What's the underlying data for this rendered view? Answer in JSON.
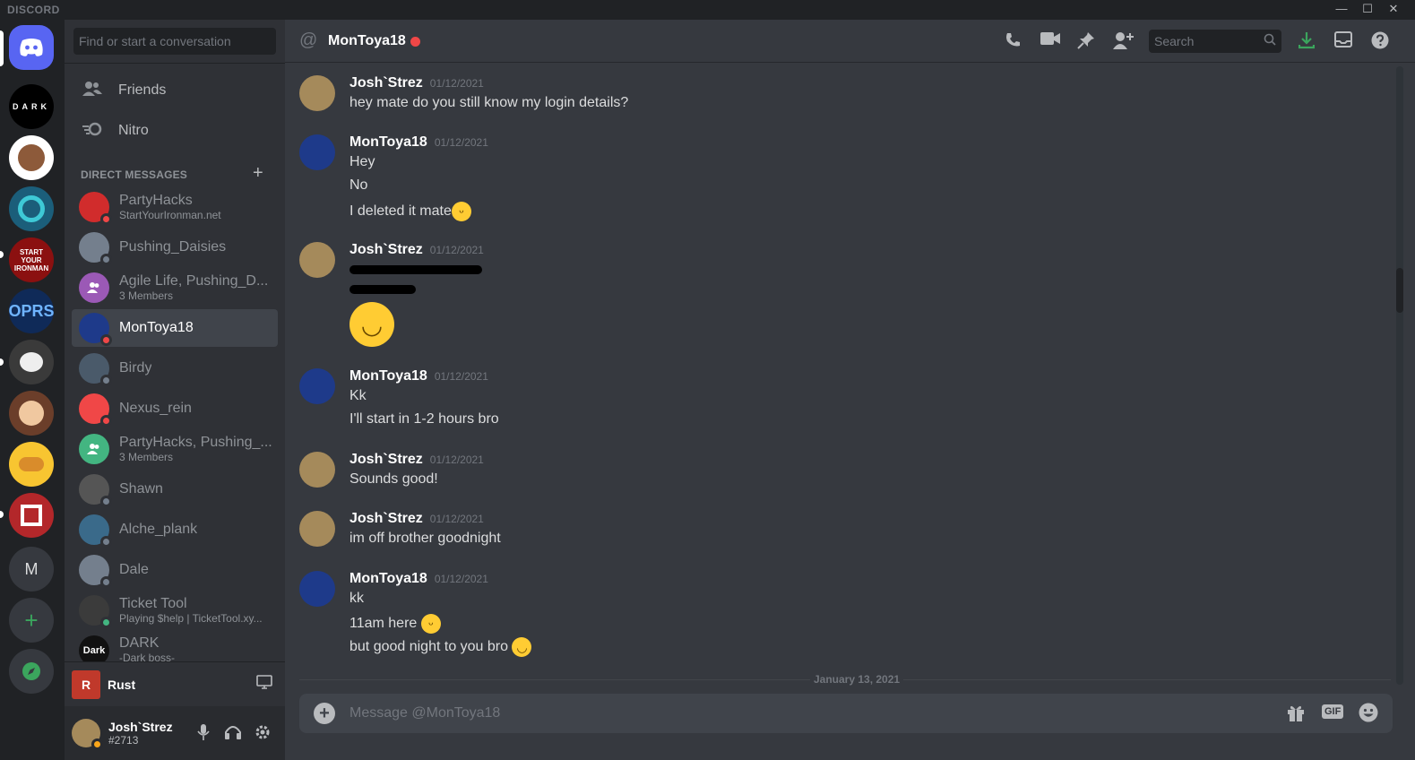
{
  "app": {
    "brand": "DISCORD",
    "window_controls": [
      "—",
      "☐",
      "✕"
    ]
  },
  "guilds": [
    {
      "label": "",
      "color": "#5865f2",
      "icon": "discord-logo-icon"
    },
    {
      "label": "DARK",
      "color": "#000000"
    },
    {
      "label": "",
      "color": "#8d5a3a"
    },
    {
      "label": "",
      "color": "#1b5e7a"
    },
    {
      "label": "START YOUR IRONMAN",
      "color": "#8b1010"
    },
    {
      "label": "OPRS",
      "color": "#0f2a58"
    },
    {
      "label": "",
      "color": "#3a3a3a"
    },
    {
      "label": "",
      "color": "#6b3e2a"
    },
    {
      "label": "",
      "color": "#f8c531"
    },
    {
      "label": "",
      "color": "#b3272a"
    },
    {
      "label": "M",
      "color": "#36393f"
    },
    {
      "label": "+",
      "color": "#36393f"
    },
    {
      "label": "",
      "color": "#36393f"
    }
  ],
  "sidebar": {
    "search_placeholder": "Find or start a conversation",
    "nav": [
      {
        "label": "Friends"
      },
      {
        "label": "Nitro"
      }
    ],
    "dm_header": "DIRECT MESSAGES",
    "dm_add": "+",
    "dms": [
      {
        "name": "PartyHacks",
        "sub": "StartYourIronman.net",
        "color": "#d12c2c",
        "status": "dnd"
      },
      {
        "name": "Pushing_Daisies",
        "sub": "",
        "color": "#747f8d",
        "status": "off"
      },
      {
        "name": "Agile Life, Pushing_D...",
        "sub": "3 Members",
        "color": "#9b59b6",
        "status": ""
      },
      {
        "name": "MonToya18",
        "sub": "",
        "color": "#1e3a8a",
        "status": "dnd"
      },
      {
        "name": "Birdy",
        "sub": "",
        "color": "#4a5a6a",
        "status": "off"
      },
      {
        "name": "Nexus_rein",
        "sub": "",
        "color": "#f04747",
        "status": "dnd"
      },
      {
        "name": "PartyHacks, Pushing_...",
        "sub": "3 Members",
        "color": "#43b581",
        "status": ""
      },
      {
        "name": "Shawn",
        "sub": "",
        "color": "#555555",
        "status": "off"
      },
      {
        "name": "Alche_plank",
        "sub": "",
        "color": "#3a6a8a",
        "status": "off"
      },
      {
        "name": "Dale",
        "sub": "",
        "color": "#747f8d",
        "status": "off"
      },
      {
        "name": "Ticket Tool",
        "sub": "Playing $help | TicketTool.xy...",
        "color": "#3b3b3b",
        "status": "on"
      },
      {
        "name": "DARK",
        "sub": "-Dark boss-",
        "color": "#111111",
        "status": "dnd",
        "avatar_text": "Dark"
      }
    ],
    "activity": {
      "game": "Rust"
    },
    "user": {
      "name": "Josh`Strez",
      "tag": "#2713"
    }
  },
  "channel": {
    "name": "MonToya18",
    "search_placeholder": "Search",
    "icons": [
      "phone-icon",
      "video-icon",
      "pin-icon",
      "add-member-icon",
      "download-icon",
      "inbox-icon",
      "help-icon"
    ]
  },
  "messages": [
    {
      "author": "Josh`Strez",
      "timestamp": "01/12/2021",
      "lines": [
        "hey mate do you still know my login details?"
      ]
    },
    {
      "author": "MonToya18",
      "timestamp": "01/12/2021",
      "lines": [
        "Hey",
        "No",
        "I deleted it mate"
      ]
    },
    {
      "author": "Josh`Strez",
      "timestamp": "01/12/2021",
      "lines": []
    },
    {
      "author": "MonToya18",
      "timestamp": "01/12/2021",
      "lines": [
        "Kk",
        "I'll start in 1-2 hours bro"
      ]
    },
    {
      "author": "Josh`Strez",
      "timestamp": "01/12/2021",
      "lines": [
        "Sounds good!"
      ]
    },
    {
      "author": "Josh`Strez",
      "timestamp": "01/12/2021",
      "lines": [
        "im off brother goodnight"
      ]
    },
    {
      "author": "MonToya18",
      "timestamp": "01/12/2021",
      "lines": [
        "kk",
        "11am here",
        "but good night to you bro"
      ]
    }
  ],
  "divider_date": "January 13, 2021",
  "composer": {
    "placeholder": "Message @MonToya18",
    "gif_label": "GIF"
  }
}
